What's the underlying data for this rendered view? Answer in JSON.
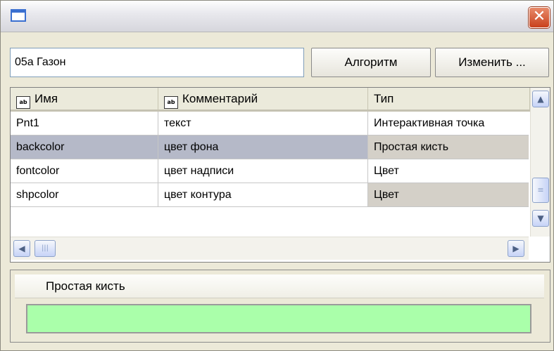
{
  "window": {
    "close_glyph": "✕"
  },
  "toolbar": {
    "name_value": "05а Газон",
    "algorithm_label": "Алгоритм",
    "edit_label": "Изменить ..."
  },
  "grid": {
    "columns": [
      {
        "label": "Имя",
        "icon": "text-field-icon"
      },
      {
        "label": "Комментарий",
        "icon": "text-field-icon"
      },
      {
        "label": "Тип"
      }
    ],
    "rows": [
      {
        "name": "Pnt1",
        "comment": "текст",
        "type": "Интерактивная точка"
      },
      {
        "name": "backcolor",
        "comment": "цвет фона",
        "type": "Простая кисть"
      },
      {
        "name": "fontcolor",
        "comment": "цвет надписи",
        "type": "Цвет"
      },
      {
        "name": "shpcolor",
        "comment": "цвет контура",
        "type": "Цвет"
      }
    ]
  },
  "property_panel": {
    "title": "Простая кисть",
    "brush_color": "#aaffaa"
  },
  "colors": {
    "selection": "#b5b9c8",
    "panel_bg": "#ece9d8"
  }
}
